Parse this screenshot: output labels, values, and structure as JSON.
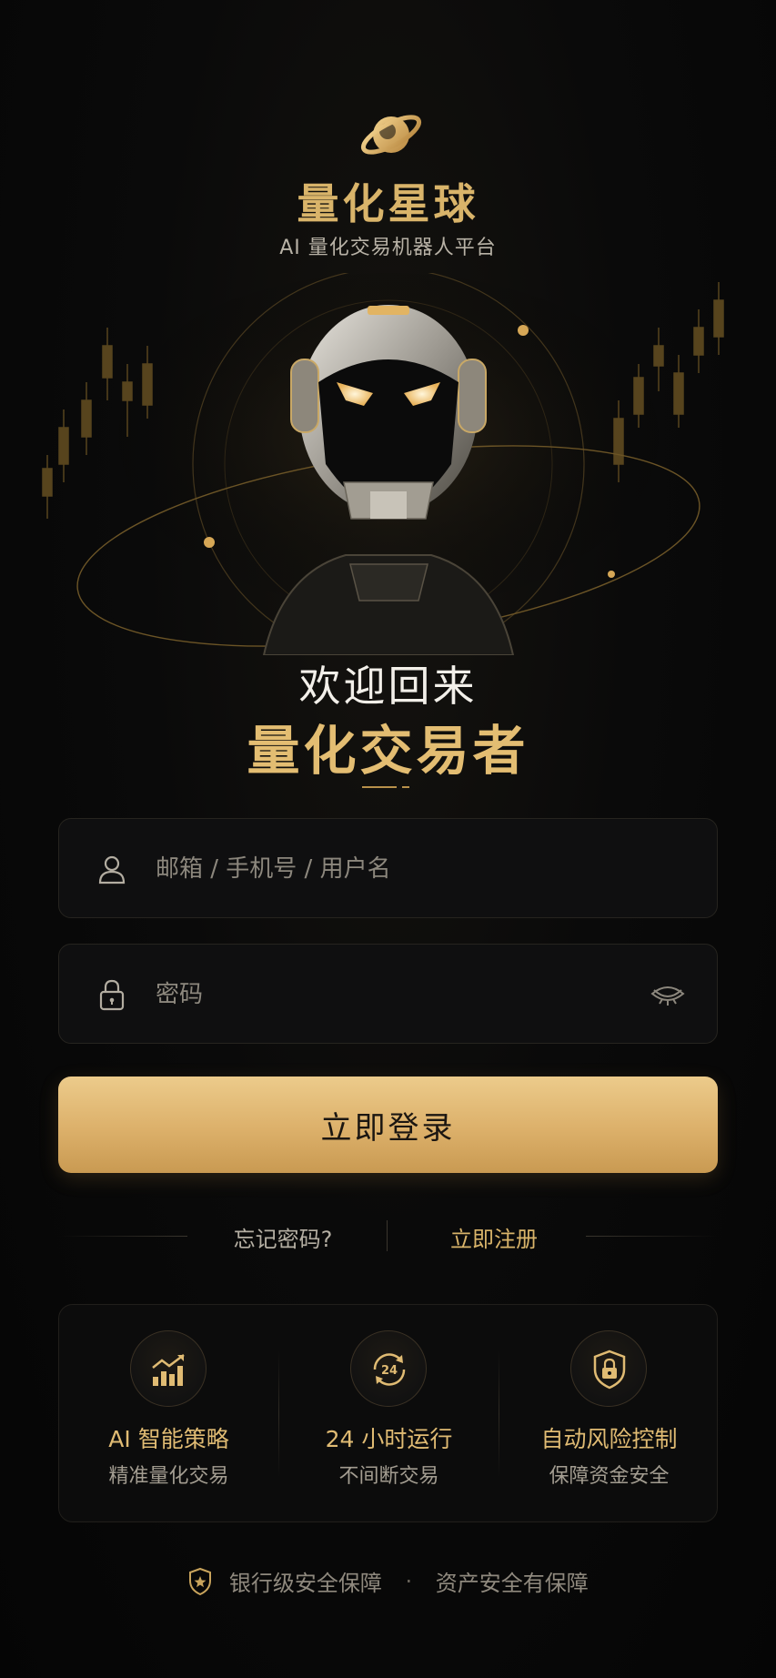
{
  "header": {
    "app_name": "量化星球",
    "tagline": "AI 量化交易机器人平台"
  },
  "welcome": {
    "line1": "欢迎回来",
    "line2": "量化交易者"
  },
  "form": {
    "username_placeholder": "邮箱 / 手机号 / 用户名",
    "password_placeholder": "密码",
    "login_label": "立即登录",
    "forgot_label": "忘记密码?",
    "register_label": "立即注册"
  },
  "features": [
    {
      "icon": "chart-up-icon",
      "title": "AI 智能策略",
      "subtitle": "精准量化交易"
    },
    {
      "icon": "clock-24-icon",
      "title": "24 小时运行",
      "subtitle": "不间断交易"
    },
    {
      "icon": "shield-lock-icon",
      "title": "自动风险控制",
      "subtitle": "保障资金安全"
    }
  ],
  "footer": {
    "left": "银行级安全保障",
    "separator": "·",
    "right": "资产安全有保障"
  },
  "colors": {
    "gold": "#d9b46a",
    "background": "#050505",
    "button_gradient_top": "#eccb8b",
    "button_gradient_bottom": "#c99a52"
  }
}
